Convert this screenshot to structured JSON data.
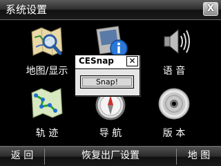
{
  "window": {
    "title": "系统设置",
    "close_label": "X"
  },
  "tiles": [
    {
      "label": "地图/显示",
      "icon": "map-magnifier-icon"
    },
    {
      "label": "",
      "icon": "info-icon"
    },
    {
      "label": "语 音",
      "icon": "speaker-icon"
    },
    {
      "label": "轨 迹",
      "icon": "track-map-icon"
    },
    {
      "label": "导 航",
      "icon": "compass-icon"
    },
    {
      "label": "版 本",
      "icon": "disc-icon"
    }
  ],
  "dialog": {
    "title": "CESnap",
    "close_label": "✕",
    "button_label": "Snap!"
  },
  "bottom_bar": {
    "back": "返 回",
    "reset": "恢复出厂设置",
    "map": "地 图"
  }
}
